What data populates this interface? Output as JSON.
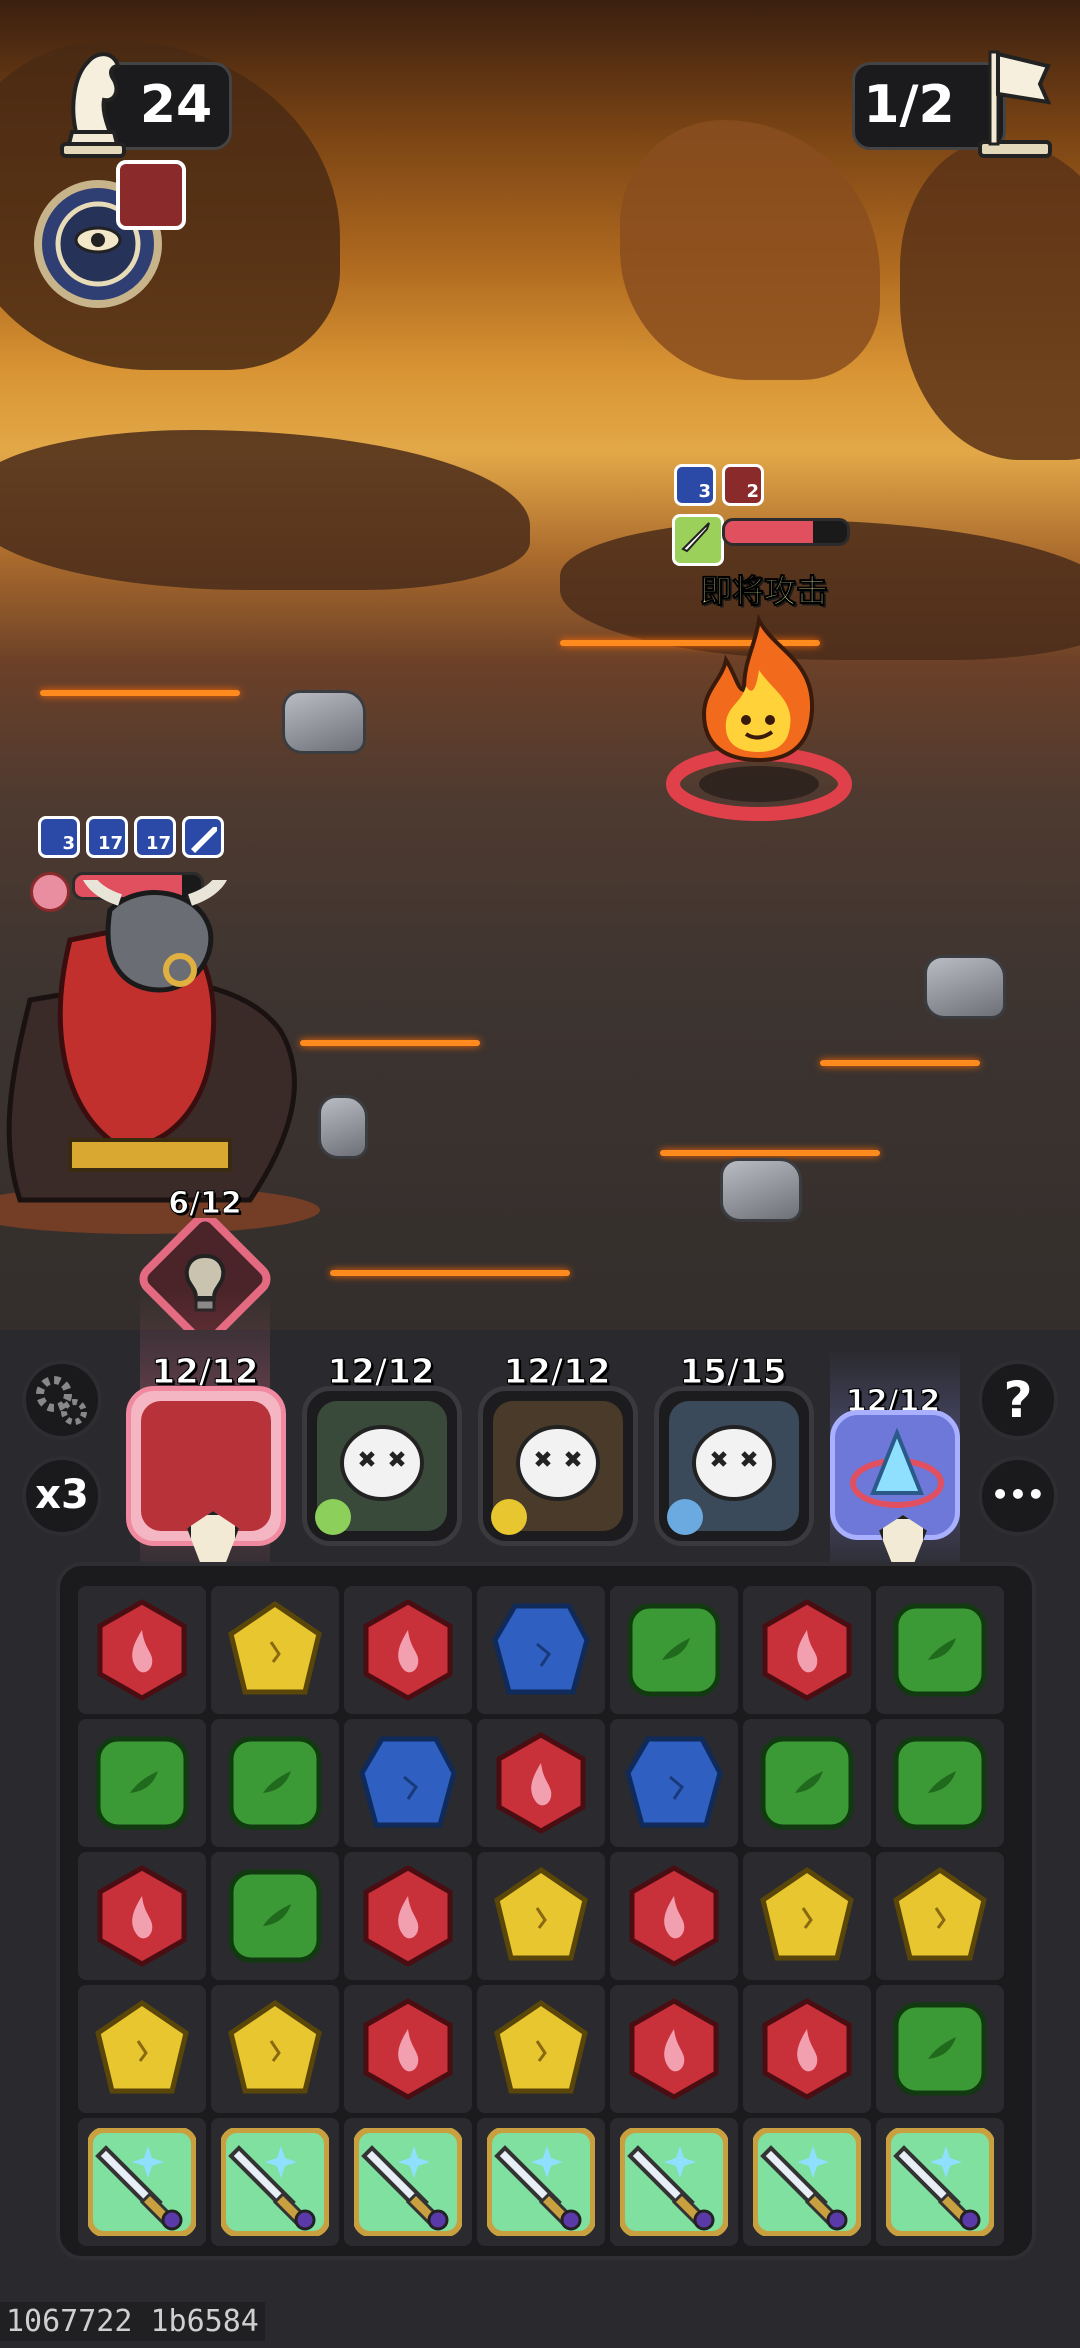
{
  "hud": {
    "moves": "24",
    "wave": "1/2"
  },
  "enemy": {
    "buffs": [
      {
        "icon": "speed-icon",
        "value": "3",
        "color": "#2b4aa8"
      },
      {
        "icon": "rage-icon",
        "value": "2",
        "color": "#8a2a2a"
      }
    ],
    "intent_label": "即将攻击",
    "hp_fraction": 0.72
  },
  "player": {
    "buffs": [
      {
        "icon": "dodge-icon",
        "value": "3"
      },
      {
        "icon": "power-icon",
        "value": "17"
      },
      {
        "icon": "shield-icon",
        "value": "17"
      },
      {
        "icon": "sword-icon",
        "value": ""
      }
    ],
    "hp_fraction": 0.85,
    "skill_charge": "6/12"
  },
  "heroes": [
    {
      "name": "minotaur-hero",
      "hp": "12/12",
      "element": "fire",
      "active": true
    },
    {
      "name": "forest-hero",
      "hp": "12/12",
      "element": "nature",
      "active": false
    },
    {
      "name": "ranger-hero",
      "hp": "12/12",
      "element": "light",
      "active": false
    },
    {
      "name": "ice-hero",
      "hp": "15/15",
      "element": "water",
      "active": false
    },
    {
      "name": "crystal-hero",
      "hp": "12/12",
      "element": "crystal",
      "active": true
    }
  ],
  "controls": {
    "speed": "x3",
    "help": "?",
    "more": "•••"
  },
  "board": {
    "rows": [
      [
        "red",
        "yellow",
        "red",
        "blue",
        "green",
        "red",
        "green"
      ],
      [
        "green",
        "green",
        "blue",
        "red",
        "blue",
        "green",
        "green"
      ],
      [
        "red",
        "green",
        "red",
        "yellow",
        "red",
        "yellow",
        "yellow"
      ],
      [
        "yellow",
        "yellow",
        "red",
        "yellow",
        "red",
        "red",
        "green"
      ],
      [
        "sword",
        "sword",
        "sword",
        "sword",
        "sword",
        "sword",
        "sword"
      ]
    ],
    "colors": {
      "red": "#c8303a",
      "yellow": "#e8c630",
      "blue": "#2f5fc0",
      "green": "#3c9a36"
    }
  },
  "footer": "1067722 1b6584"
}
